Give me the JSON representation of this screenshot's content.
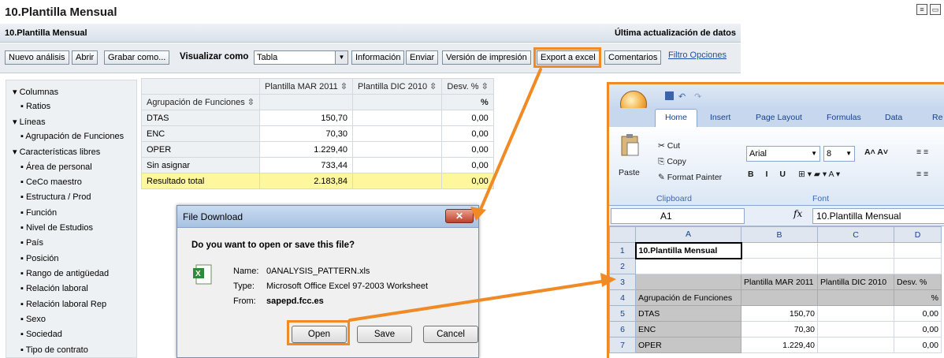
{
  "header": {
    "title": "10.Plantilla Mensual"
  },
  "subheader": {
    "title": "10.Plantilla Mensual",
    "updated_label": "Última actualización de datos"
  },
  "toolbar": {
    "buttons": [
      "Nuevo análisis",
      "Abrir",
      "Grabar como...",
      "Información",
      "Enviar",
      "Versión de impresión",
      "Export a excel",
      "Comentarios"
    ],
    "visualize_label": "Visualizar como",
    "visualize_value": "Tabla",
    "links": [
      "Filtro",
      "Opciones"
    ]
  },
  "nav": {
    "sections": [
      {
        "label": "Columnas",
        "items": [
          "Ratios"
        ]
      },
      {
        "label": "Líneas",
        "items": [
          "Agrupación de Funciones"
        ]
      },
      {
        "label": "Características libres",
        "items": [
          "Área de personal",
          "CeCo maestro",
          "Estructura / Prod",
          "Función",
          "Nivel de Estudios",
          "País",
          "Posición",
          "Rango de antigüedad",
          "Relación laboral",
          "Relación laboral Rep",
          "Sexo",
          "Sociedad",
          "Tipo de contrato"
        ]
      }
    ]
  },
  "grid": {
    "row_header_label": "Agrupación de Funciones",
    "columns": [
      "Plantilla MAR 2011",
      "Plantilla DIC 2010",
      "Desv. %"
    ],
    "unit_row": [
      "",
      "",
      "%"
    ],
    "rows": [
      {
        "label": "DTAS",
        "values": [
          "150,70",
          "",
          "0,00"
        ]
      },
      {
        "label": "ENC",
        "values": [
          "70,30",
          "",
          "0,00"
        ]
      },
      {
        "label": "OPER",
        "values": [
          "1.229,40",
          "",
          "0,00"
        ]
      },
      {
        "label": "Sin asignar",
        "values": [
          "733,44",
          "",
          "0,00"
        ]
      }
    ],
    "total": {
      "label": "Resultado total",
      "values": [
        "2.183,84",
        "",
        "0,00"
      ]
    }
  },
  "dialog": {
    "title": "File Download",
    "close_glyph": "✕",
    "question": "Do you want to open or save this file?",
    "name_label": "Name:",
    "name_value": "0ANALYSIS_PATTERN.xls",
    "type_label": "Type:",
    "type_value": "Microsoft Office Excel 97-2003 Worksheet",
    "from_label": "From:",
    "from_value": "sapepd.fcc.es",
    "buttons": [
      "Open",
      "Save",
      "Cancel"
    ]
  },
  "excel": {
    "tabs": [
      "Home",
      "Insert",
      "Page Layout",
      "Formulas",
      "Data",
      "Re"
    ],
    "clipboard": {
      "paste": "Paste",
      "cut": "Cut",
      "copy": "Copy",
      "format_painter": "Format Painter",
      "group": "Clipboard"
    },
    "font": {
      "name": "Arial",
      "size": "8",
      "group": "Font"
    },
    "name_box": "A1",
    "fx": "fx",
    "formula_value": "10.Plantilla Mensual",
    "col_headers": [
      "A",
      "B",
      "C",
      "D"
    ],
    "rows": [
      {
        "n": "1",
        "cells": [
          "10.Plantilla Mensual",
          "",
          "",
          ""
        ]
      },
      {
        "n": "2",
        "cells": [
          "",
          "",
          "",
          ""
        ]
      },
      {
        "n": "3",
        "cells": [
          "",
          "Plantilla MAR 2011",
          "Plantilla DIC 2010",
          "Desv. %"
        ]
      },
      {
        "n": "4",
        "cells": [
          "Agrupación de Funciones",
          "",
          "",
          "%"
        ]
      },
      {
        "n": "5",
        "cells": [
          "DTAS",
          "150,70",
          "",
          "0,00"
        ]
      },
      {
        "n": "6",
        "cells": [
          "ENC",
          "70,30",
          "",
          "0,00"
        ]
      },
      {
        "n": "7",
        "cells": [
          "OPER",
          "1.229,40",
          "",
          "0,00"
        ]
      }
    ]
  },
  "colors": {
    "highlight": "#f08a24",
    "total_row": "#fff79c"
  }
}
